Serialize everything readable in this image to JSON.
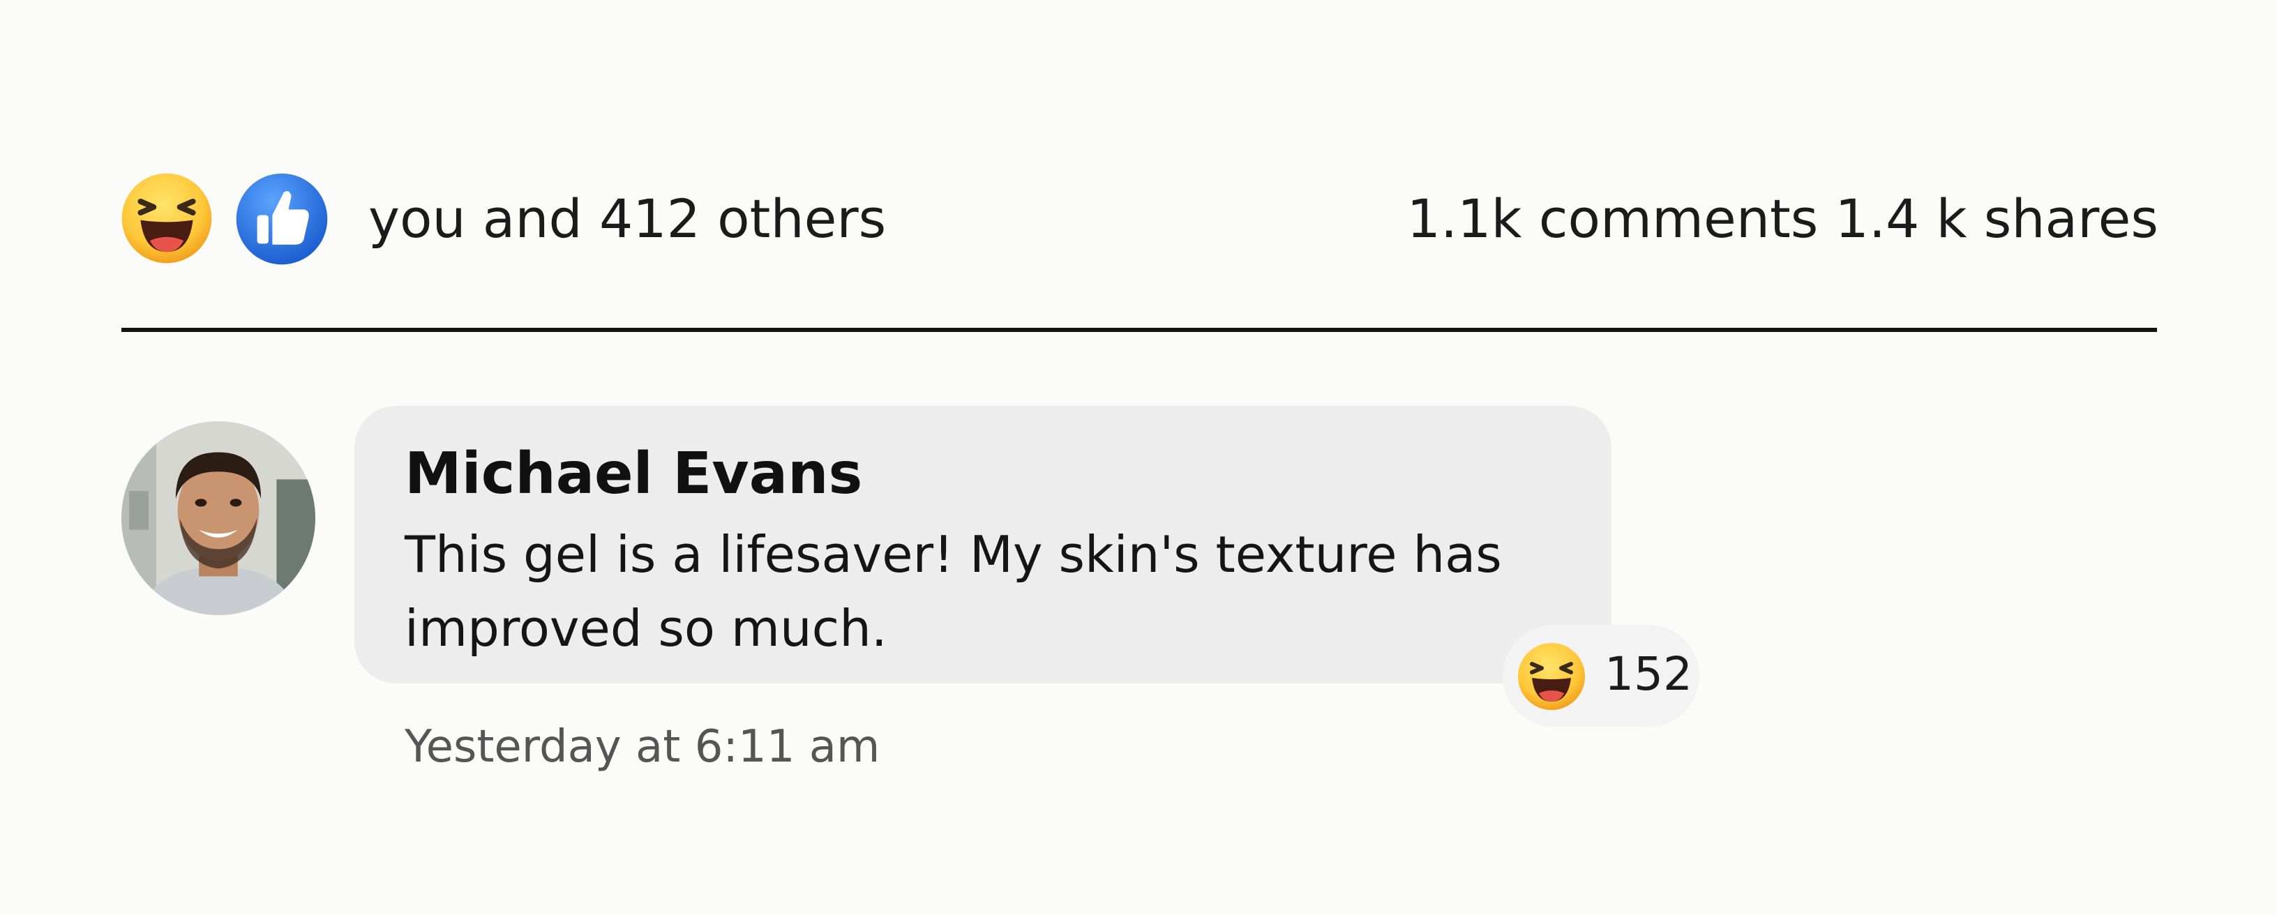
{
  "reactions": {
    "icons": [
      "laughing-emoji-icon",
      "thumbs-up-like-icon"
    ],
    "summary": "you and 412 others",
    "stats": "1.1k comments 1.4 k shares"
  },
  "comment": {
    "author": "Michael Evans",
    "text": "This gel is a lifesaver! My skin's texture has improved so much.",
    "reaction_icon": "laughing-emoji-icon",
    "reaction_count": "152",
    "timestamp": "Yesterday at 6:11 am"
  },
  "colors": {
    "like_blue": "#2a6fe0",
    "emoji_yellow": "#ffcd3c",
    "bubble_bg": "#ededed"
  }
}
